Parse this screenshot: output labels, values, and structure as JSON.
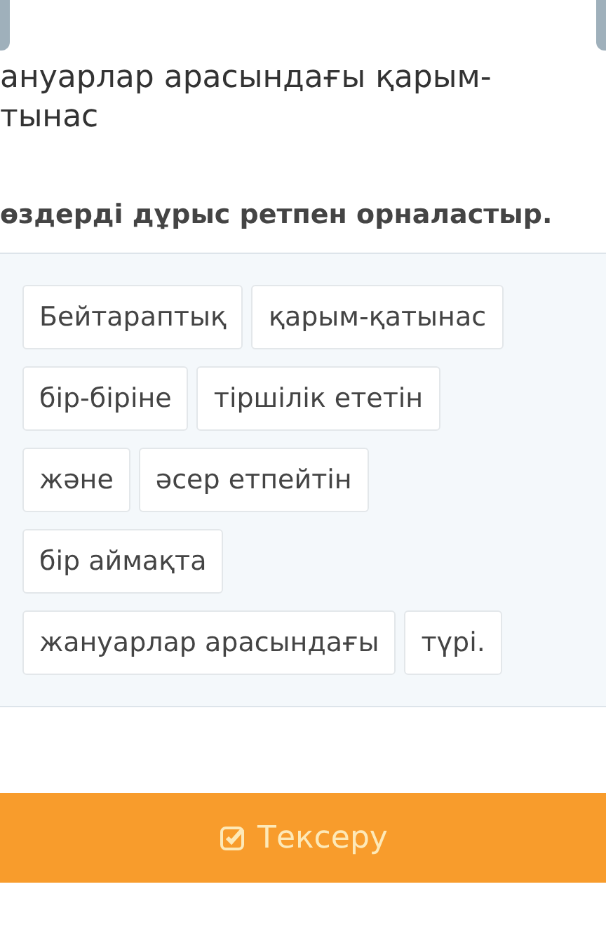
{
  "title_lines": [
    "ануарлар арасындағы қарым-",
    "тынас"
  ],
  "instruction": "өздерді дұрыс ретпен орналастыр.",
  "words": [
    [
      "Бейтараптық",
      "қарым-қатынас"
    ],
    [
      "бір-біріне",
      "тіршілік ететін"
    ],
    [
      "және",
      "әсер етпейтін"
    ],
    [
      "бір аймақта"
    ],
    [
      "жануарлар арасындағы",
      "түрі."
    ]
  ],
  "check_button": {
    "label": "Тексеру"
  }
}
